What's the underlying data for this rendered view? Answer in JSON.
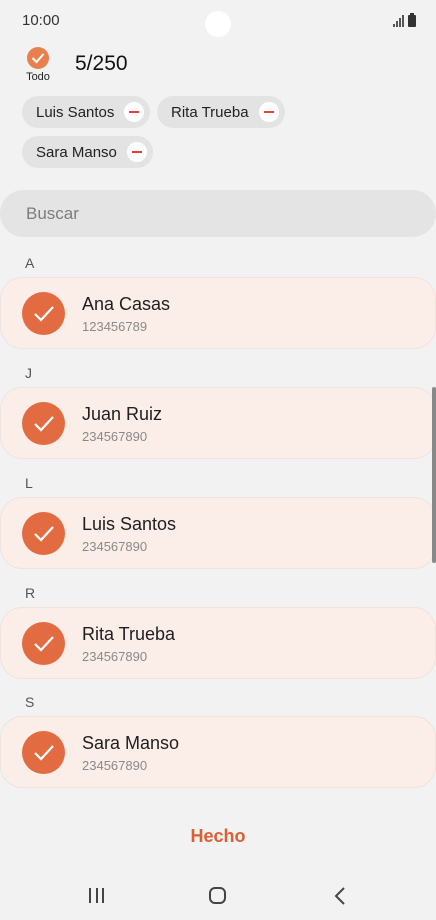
{
  "status_bar": {
    "time": "10:00"
  },
  "header": {
    "select_all_label": "Todo",
    "count": "5/250"
  },
  "chips": [
    {
      "label": "Luis Santos"
    },
    {
      "label": "Rita Trueba"
    },
    {
      "label": "Sara Manso"
    }
  ],
  "search": {
    "placeholder": "Buscar"
  },
  "sections": [
    {
      "letter": "A",
      "contact": {
        "name": "Ana Casas",
        "number": "123456789",
        "checked": true
      }
    },
    {
      "letter": "J",
      "contact": {
        "name": "Juan Ruiz",
        "number": "234567890",
        "checked": true
      }
    },
    {
      "letter": "L",
      "contact": {
        "name": "Luis Santos",
        "number": "234567890",
        "checked": true
      }
    },
    {
      "letter": "R",
      "contact": {
        "name": "Rita Trueba",
        "number": "234567890",
        "checked": true
      }
    },
    {
      "letter": "S",
      "contact": {
        "name": "Sara Manso",
        "number": "234567890",
        "checked": true
      }
    }
  ],
  "footer": {
    "done_label": "Hecho"
  },
  "colors": {
    "accent": "#e36b42",
    "done": "#db5f33",
    "card": "#fbede7",
    "remove": "#e5432f"
  },
  "nav": {
    "recents_icon": "recents-icon",
    "home_icon": "home-icon",
    "back_icon": "back-icon"
  }
}
